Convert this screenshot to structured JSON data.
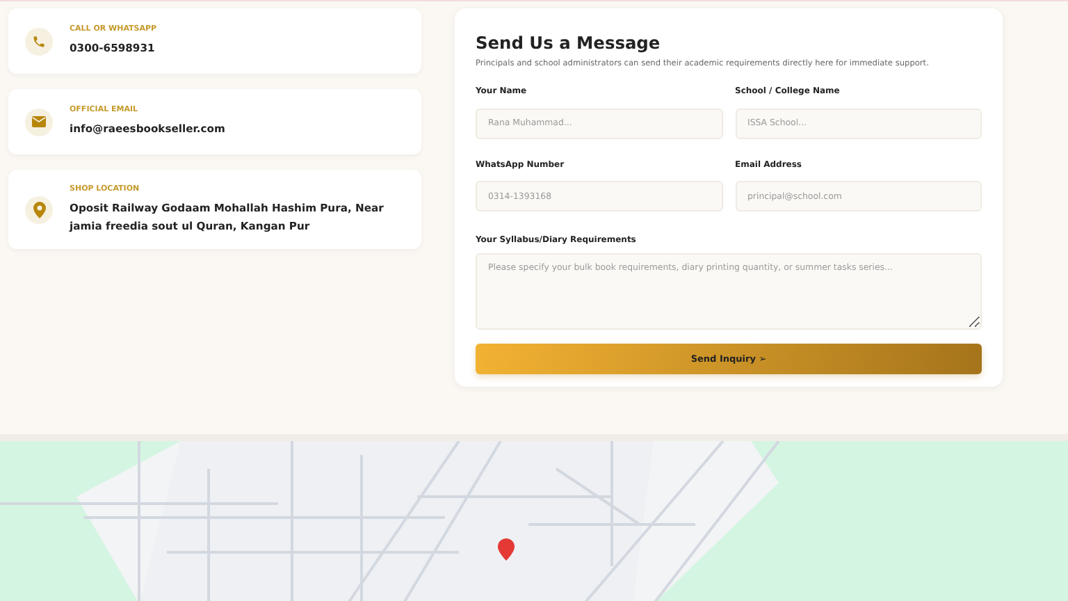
{
  "contact_cards": [
    {
      "kind": "phone",
      "label": "CALL OR WHATSAPP",
      "value": "0300-6598931"
    },
    {
      "kind": "email",
      "label": "OFFICIAL EMAIL",
      "value": "info@raeesbookseller.com"
    },
    {
      "kind": "location",
      "label": "SHOP LOCATION",
      "value": "Oposit Railway Godaam Mohallah Hashim Pura, Near jamia freedia sout ul Quran, Kangan Pur"
    }
  ],
  "form": {
    "title": "Send Us a Message",
    "subtitle": "Principals and school administrators can send their academic requirements directly here for immediate support.",
    "fields": [
      {
        "label": "Your Name",
        "placeholder": "Rana Muhammad..."
      },
      {
        "label": "School / College Name",
        "placeholder": "ISSA School..."
      },
      {
        "label": "WhatsApp Number",
        "placeholder": "0314-1393168"
      },
      {
        "label": "Email Address",
        "placeholder": "principal@school.com"
      }
    ],
    "requirements": {
      "label": "Your Syllabus/Diary Requirements",
      "placeholder": "Please specify your bulk book requirements, diary printing quantity, or summer tasks series..."
    },
    "submit": {
      "label": "Send Inquiry",
      "icon": "➢"
    }
  }
}
